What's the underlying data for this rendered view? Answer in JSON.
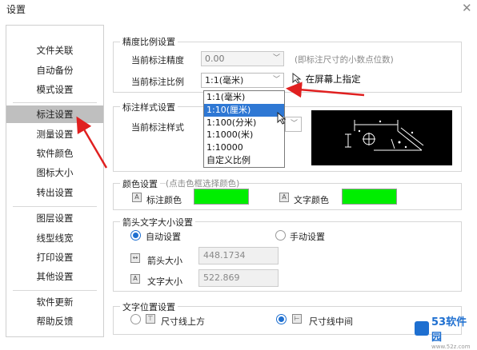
{
  "window": {
    "title": "设置",
    "close_glyph": "✕"
  },
  "sidebar": {
    "items": [
      {
        "label": "文件关联"
      },
      {
        "label": "自动备份"
      },
      {
        "label": "模式设置"
      },
      {
        "label": "标注设置",
        "active": true
      },
      {
        "label": "测量设置"
      },
      {
        "label": "软件颜色"
      },
      {
        "label": "图标大小"
      },
      {
        "label": "转出设置"
      },
      {
        "label": "图层设置"
      },
      {
        "label": "线型线宽"
      },
      {
        "label": "打印设置"
      },
      {
        "label": "其他设置"
      },
      {
        "label": "软件更新"
      },
      {
        "label": "帮助反馈"
      }
    ]
  },
  "precision": {
    "title": "精度比例设置",
    "precision_label": "当前标注精度",
    "precision_value": "0.00",
    "precision_hint": "(即标注尺寸的小数点位数)",
    "scale_label": "当前标注比例",
    "scale_value": "1:1(毫米)",
    "picker_label": "在屏幕上指定",
    "scale_options": [
      "1:1(毫米)",
      "1:10(厘米)",
      "1:100(分米)",
      "1:1000(米)",
      "1:10000",
      "自定义比例"
    ],
    "selected_option": "1:10(厘米)"
  },
  "style": {
    "title": "标注样式设置",
    "style_label": "当前标注样式"
  },
  "color": {
    "title": "颜色设置",
    "hint": "(点击色框选择颜色)",
    "dim_color_label": "标注颜色",
    "text_color_label": "文字颜色",
    "dim_color": "#00ee00",
    "text_color": "#00ee00"
  },
  "size": {
    "title": "箭头文字大小设置",
    "auto_label": "自动设置",
    "manual_label": "手动设置",
    "arrow_label": "箭头大小",
    "arrow_value": "448.1734",
    "text_label": "文字大小",
    "text_value": "522.869"
  },
  "position": {
    "title": "文字位置设置",
    "above_label": "尺寸线上方",
    "middle_label": "尺寸线中间"
  },
  "watermark": {
    "text": "53软件园",
    "sub": "www.52z.com"
  }
}
